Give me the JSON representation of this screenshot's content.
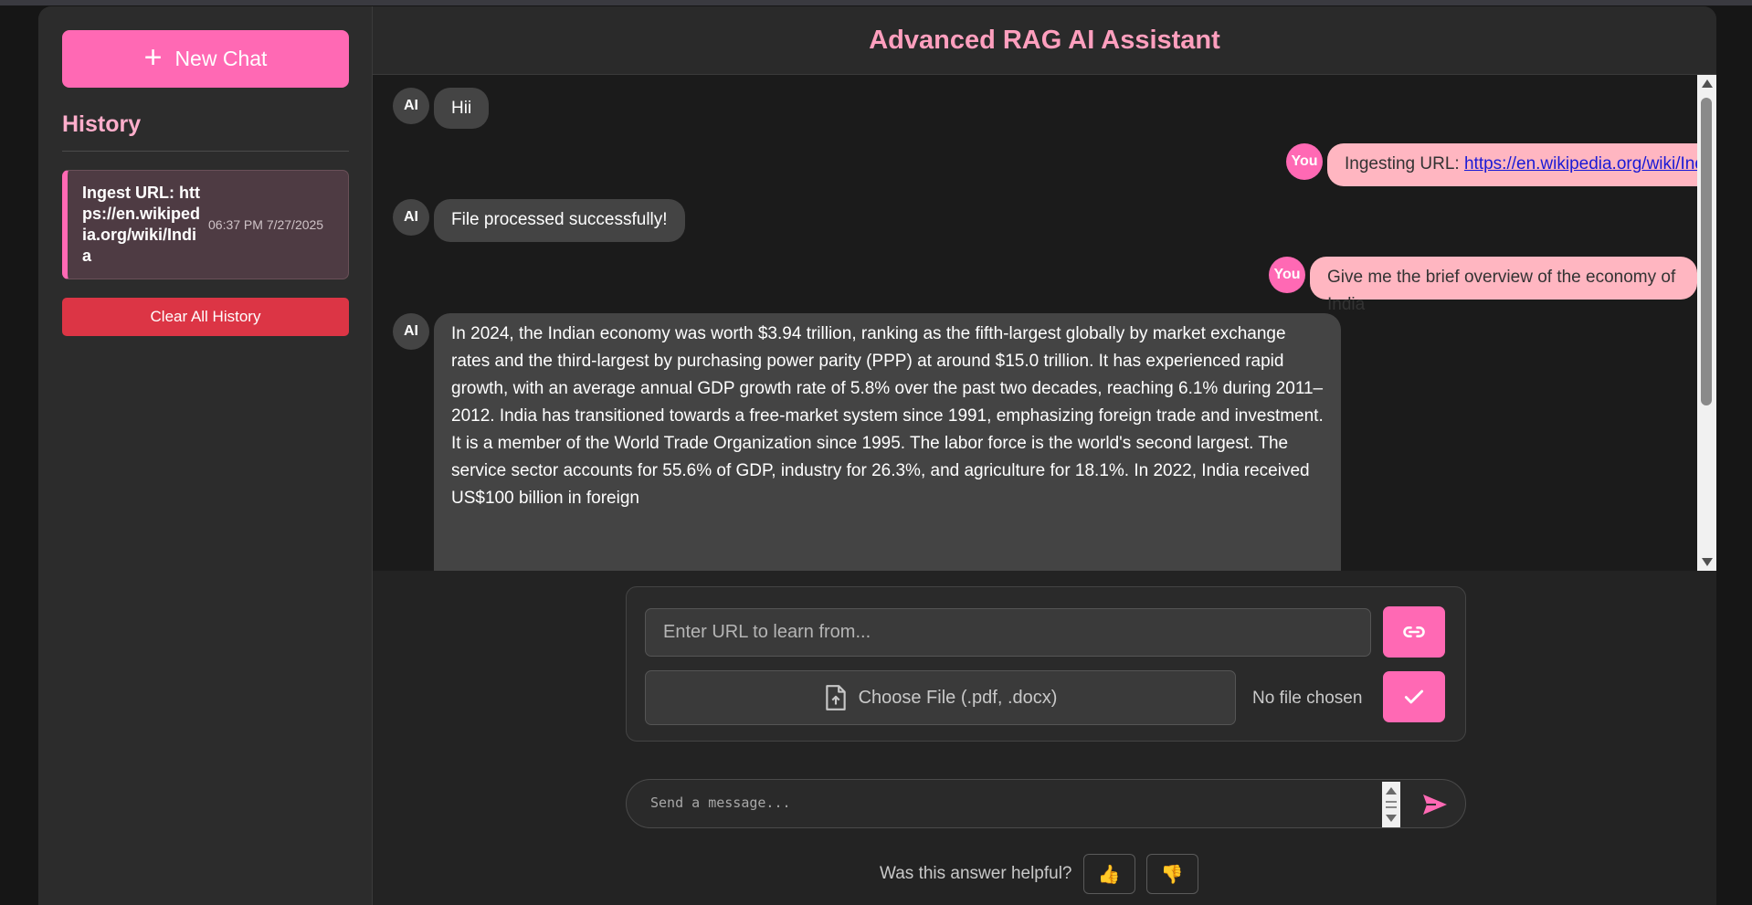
{
  "sidebar": {
    "new_chat_label": "New Chat",
    "history_title": "History",
    "history_items": [
      {
        "title": "Ingest URL: https://en.wikipedia.org/wiki/India",
        "time": "06:37 PM 7/27/2025"
      }
    ],
    "clear_label": "Clear All History"
  },
  "header": {
    "title": "Advanced RAG AI Assistant"
  },
  "messages": [
    {
      "role": "AI",
      "text": "Hii"
    },
    {
      "role": "You",
      "prefix": "Ingesting URL: ",
      "link": "https://en.wikipedia.org/wiki/India"
    },
    {
      "role": "AI",
      "text": "File processed successfully!"
    },
    {
      "role": "You",
      "text": "Give me the brief overview of the economy of India"
    },
    {
      "role": "AI",
      "text": "In 2024, the Indian economy was worth $3.94 trillion, ranking as the fifth-largest globally by market exchange rates and the third-largest by purchasing power parity (PPP) at around $15.0 trillion. It has experienced rapid growth, with an average annual GDP growth rate of 5.8% over the past two decades, reaching 6.1% during 2011–2012. India has transitioned towards a free-market system since 1991, emphasizing foreign trade and investment. It is a member of the World Trade Organization since 1995. The labor force is the world's second largest. The service sector accounts for 55.6% of GDP, industry for 26.3%, and agriculture for 18.1%. In 2022, India received US$100 billion in foreign"
    }
  ],
  "input": {
    "url_placeholder": "Enter URL to learn from...",
    "file_label": "Choose File (.pdf, .docx)",
    "no_file": "No file chosen",
    "message_placeholder": "Send a message..."
  },
  "feedback": {
    "question": "Was this answer helpful?",
    "thumbs_up": "👍",
    "thumbs_down": "👎"
  },
  "colors": {
    "accent": "#ff69b4",
    "danger": "#dc3545",
    "user_bubble": "#ffb6c1",
    "ai_bubble": "#444444",
    "title": "#ff9fbe"
  },
  "icons": [
    "plus-icon",
    "link-icon",
    "file-upload-icon",
    "check-icon",
    "send-icon"
  ]
}
